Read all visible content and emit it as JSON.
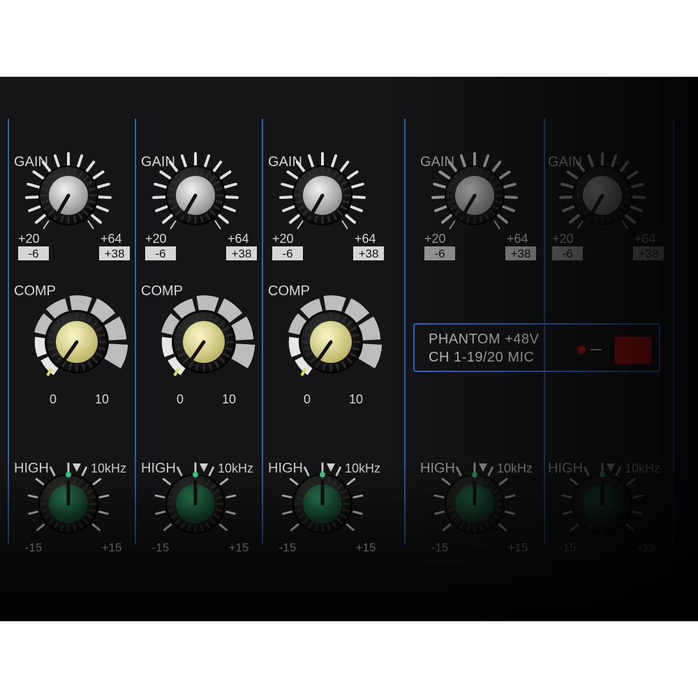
{
  "gain_section": {
    "label": "GAIN",
    "left_scale_top": "+20",
    "left_scale_bottom": "-6",
    "right_scale_top": "+64",
    "right_scale_bottom": "+38"
  },
  "comp_section": {
    "label": "COMP",
    "scale_min": "0",
    "scale_max": "10"
  },
  "high_eq_section": {
    "label": "HIGH",
    "frequency": "10kHz",
    "scale_min": "-15",
    "scale_max": "+15"
  },
  "phantom": {
    "line1": "PHANTOM  +48V",
    "line2": "CH 1-19/20  MIC"
  },
  "colors": {
    "panel": "#151517",
    "divider": "#2c6fd0",
    "comp_knob": "#e9e6a6",
    "high_knob": "#1d5a3b",
    "gain_knob": "#d8d8d8",
    "phantom_switch": "#a8140f"
  }
}
